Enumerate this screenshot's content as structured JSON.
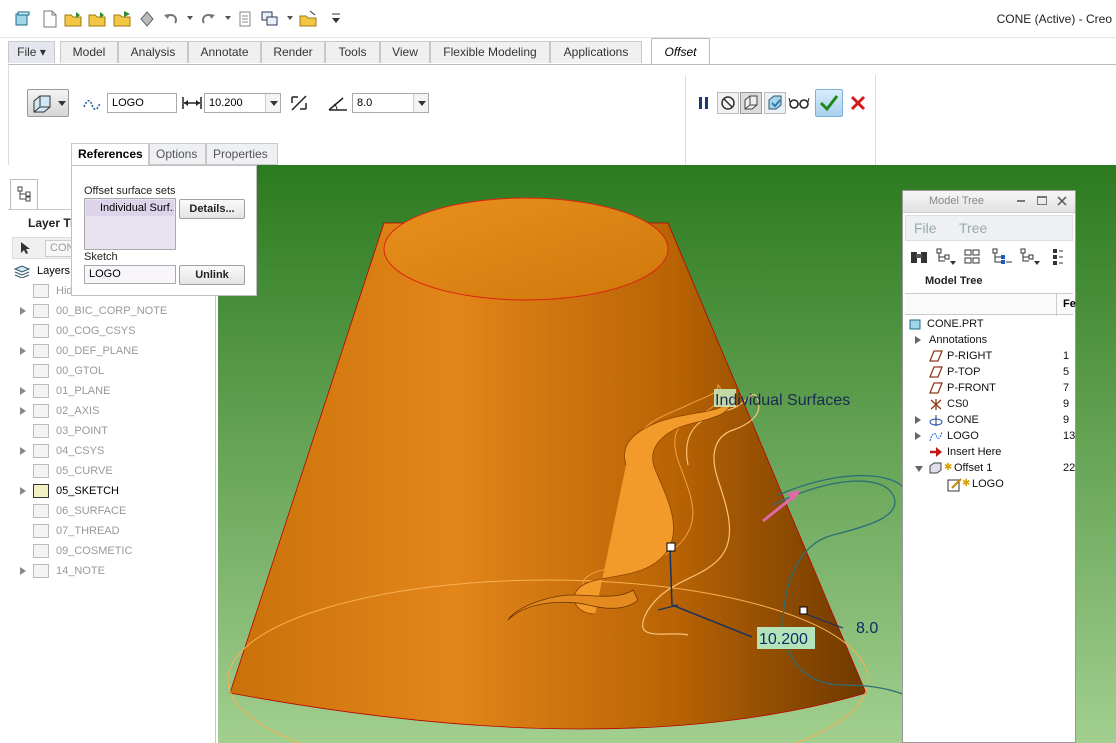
{
  "window": {
    "title": "CONE (Active) - Creo"
  },
  "quick_access": [
    {
      "icon": "cube-icon"
    },
    {
      "icon": "new-file-icon"
    },
    {
      "icon": "open-folder-icon"
    },
    {
      "icon": "open-folder-icon"
    },
    {
      "icon": "save-icon"
    },
    {
      "icon": "regenerate-icon"
    },
    {
      "icon": "undo-icon"
    },
    {
      "icon": "redo-icon"
    },
    {
      "icon": "copy-icon"
    },
    {
      "icon": "windows-icon"
    },
    {
      "icon": "close-window-icon"
    },
    {
      "icon": "customize-icon"
    }
  ],
  "tabs": [
    "File",
    "Model",
    "Analysis",
    "Annotate",
    "Render",
    "Tools",
    "View",
    "Flexible Modeling",
    "Applications",
    "Offset"
  ],
  "active_tab": "Offset",
  "ribbon": {
    "sketch_name": "LOGO",
    "offset_distance": "10.200",
    "angle": "8.0"
  },
  "subtabs": [
    "References",
    "Options",
    "Properties"
  ],
  "references_panel": {
    "offset_surface_sets_label": "Offset surface sets",
    "surface_set_item": "Individual Surf...",
    "details_button": "Details...",
    "sketch_label": "Sketch",
    "sketch_value": "LOGO",
    "unlink_button": "Unlink"
  },
  "left_panel": {
    "title": "Layer Tr",
    "filter_value": "CON",
    "layers_header": "Layers",
    "layers": [
      {
        "name": "Hid",
        "expandable": false,
        "active": false
      },
      {
        "name": "00_BIC_CORP_NOTE",
        "expandable": true,
        "active": false
      },
      {
        "name": "00_COG_CSYS",
        "expandable": false,
        "active": false
      },
      {
        "name": "00_DEF_PLANE",
        "expandable": true,
        "active": false
      },
      {
        "name": "00_GTOL",
        "expandable": false,
        "active": false
      },
      {
        "name": "01_PLANE",
        "expandable": true,
        "active": false
      },
      {
        "name": "02_AXIS",
        "expandable": true,
        "active": false
      },
      {
        "name": "03_POINT",
        "expandable": false,
        "active": false
      },
      {
        "name": "04_CSYS",
        "expandable": true,
        "active": false
      },
      {
        "name": "05_CURVE",
        "expandable": false,
        "active": false
      },
      {
        "name": "05_SKETCH",
        "expandable": true,
        "active": true
      },
      {
        "name": "06_SURFACE",
        "expandable": false,
        "active": false
      },
      {
        "name": "07_THREAD",
        "expandable": false,
        "active": false
      },
      {
        "name": "09_COSMETIC",
        "expandable": false,
        "active": false
      },
      {
        "name": "14_NOTE",
        "expandable": true,
        "active": false
      }
    ]
  },
  "viewport": {
    "annotation_label": "Individual Surfaces",
    "distance_dim": "10.200",
    "angle_dim": "8.0",
    "background_top": "#2c7a1f",
    "background_bottom": "#a2cf8f",
    "model_color": "#d97b08"
  },
  "model_tree": {
    "window_title": "Model Tree",
    "menu": [
      "File",
      "Tree"
    ],
    "header": "Model Tree",
    "column_header": "Fe",
    "items": [
      {
        "label": "CONE.PRT",
        "icon": "part-icon",
        "feat": ""
      },
      {
        "label": "Annotations",
        "icon": "",
        "feat": ""
      },
      {
        "label": "P-RIGHT",
        "icon": "datum-plane-icon",
        "feat": "1"
      },
      {
        "label": "P-TOP",
        "icon": "datum-plane-icon",
        "feat": "5"
      },
      {
        "label": "P-FRONT",
        "icon": "datum-plane-icon",
        "feat": "7"
      },
      {
        "label": "CS0",
        "icon": "csys-icon",
        "feat": "9"
      },
      {
        "label": "CONE",
        "icon": "revolve-icon",
        "feat": "9"
      },
      {
        "label": "LOGO",
        "icon": "sketch-icon",
        "feat": "13"
      },
      {
        "label": "Insert Here",
        "icon": "insert-arrow-icon",
        "feat": ""
      },
      {
        "label": "Offset 1",
        "icon": "offset-icon",
        "feat": "22"
      },
      {
        "label": "LOGO",
        "icon": "sketch-edit-icon",
        "feat": ""
      }
    ]
  }
}
